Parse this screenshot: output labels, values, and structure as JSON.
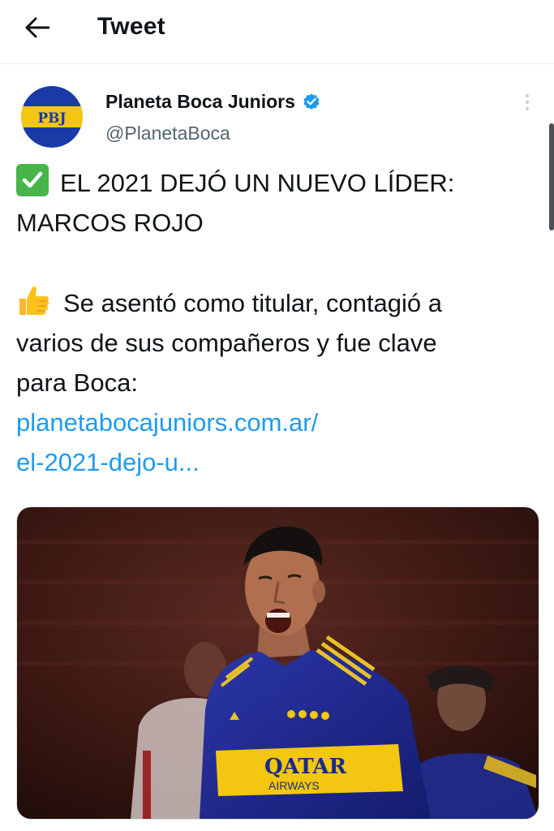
{
  "header": {
    "title": "Tweet",
    "back_icon": "arrow-left-icon"
  },
  "author": {
    "avatar_text": "PBJ",
    "name": "Planeta Boca Juniors",
    "handle": "@PlanetaBoca",
    "verified": true,
    "verified_color": "#1d9bf0"
  },
  "tweet": {
    "line1_icon": "check-mark-button-emoji",
    "line1": "EL 2021 DEJÓ UN NUEVO LÍDER:",
    "line2": "MARCOS ROJO",
    "line3_icon": "thumbs-up-emoji",
    "line3": "Se asentó como titular, contagió a",
    "line4": "varios de sus compañeros y fue clave",
    "line5": "para Boca:",
    "link_line1": "planetabocajuniors.com.ar/",
    "link_line2": "el-2021-dejo-u..."
  },
  "media": {
    "jersey_sponsor": "QATAR",
    "jersey_sponsor_sub": "AIRWAYS"
  },
  "colors": {
    "link": "#1d9bf0",
    "secondary_text": "#536471",
    "boca_blue": "#1a3aa8",
    "boca_gold": "#f3c611"
  }
}
